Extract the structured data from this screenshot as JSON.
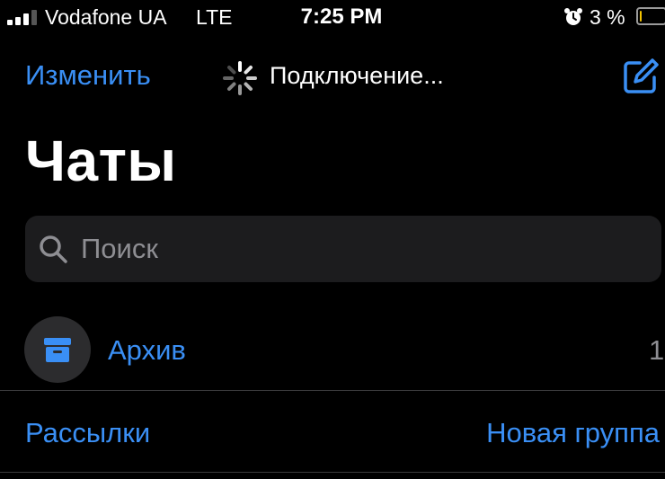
{
  "status_bar": {
    "carrier": "Vodafone UA",
    "network": "LTE",
    "time": "7:25 PM",
    "battery_percent": "3 %",
    "signal_bars_active": 3,
    "signal_bars_total": 4,
    "battery_level": 0.03,
    "icons": [
      "signal-icon",
      "alarm-icon",
      "battery-icon"
    ]
  },
  "nav": {
    "edit_label": "Изменить",
    "status_text": "Подключение...",
    "icons": [
      "spinner-icon",
      "compose-icon"
    ]
  },
  "page": {
    "title": "Чаты"
  },
  "search": {
    "placeholder": "Поиск",
    "icon": "search-icon"
  },
  "archive": {
    "label": "Архив",
    "count": "1",
    "icon": "archive-icon"
  },
  "actions": {
    "broadcast_label": "Рассылки",
    "new_group_label": "Новая группа"
  },
  "colors": {
    "background": "#000000",
    "accent": "#3a8ff5",
    "secondary_text": "#8e8e93",
    "field_background": "#1c1c1e",
    "separator": "#3a3a3c",
    "battery_low": "#f5c400"
  }
}
